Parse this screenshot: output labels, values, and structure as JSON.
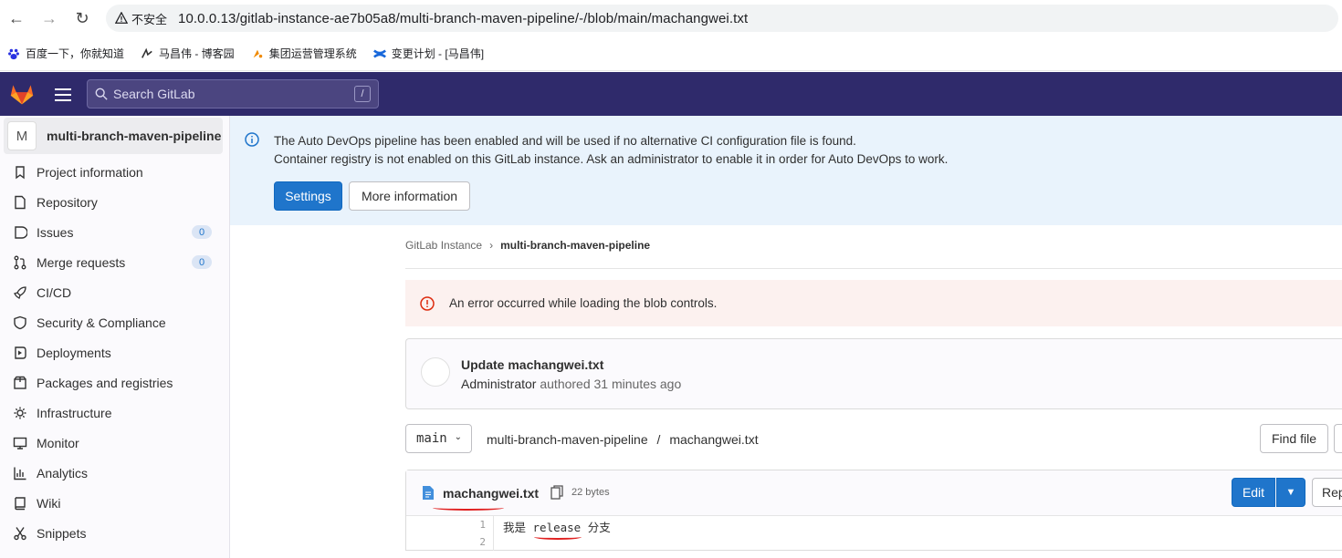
{
  "browser": {
    "insecure_label": "不安全",
    "url": "10.0.0.13/gitlab-instance-ae7b05a8/multi-branch-maven-pipeline/-/blob/main/machangwei.txt",
    "bookmarks": [
      "百度一下，你就知道",
      "马昌伟 - 博客园",
      "集团运营管理系统",
      "变更计划 - [马昌伟]"
    ]
  },
  "topbar": {
    "search_placeholder": "Search GitLab",
    "search_shortcut": "/"
  },
  "sidebar": {
    "project_initial": "M",
    "project_name": "multi-branch-maven-pipeline",
    "items": [
      {
        "label": "Project information"
      },
      {
        "label": "Repository"
      },
      {
        "label": "Issues",
        "count": "0"
      },
      {
        "label": "Merge requests",
        "count": "0"
      },
      {
        "label": "CI/CD"
      },
      {
        "label": "Security & Compliance"
      },
      {
        "label": "Deployments"
      },
      {
        "label": "Packages and registries"
      },
      {
        "label": "Infrastructure"
      },
      {
        "label": "Monitor"
      },
      {
        "label": "Analytics"
      },
      {
        "label": "Wiki"
      },
      {
        "label": "Snippets"
      }
    ]
  },
  "banner": {
    "line1": "The Auto DevOps pipeline has been enabled and will be used if no alternative CI configuration file is found.",
    "line2": "Container registry is not enabled on this GitLab instance. Ask an administrator to enable it in order for Auto DevOps to work.",
    "settings_label": "Settings",
    "more_info_label": "More information"
  },
  "breadcrumb": {
    "root": "GitLab Instance",
    "current": "multi-branch-maven-pipeline"
  },
  "error": {
    "message": "An error occurred while loading the blob controls."
  },
  "commit": {
    "title": "Update machangwei.txt",
    "author": "Administrator",
    "meta": "authored 31 minutes ago"
  },
  "file_nav": {
    "branch": "main",
    "project": "multi-branch-maven-pipeline",
    "separator": "/",
    "file": "machangwei.txt",
    "find_file_label": "Find file"
  },
  "file": {
    "name": "machangwei.txt",
    "size": "22 bytes",
    "edit_label": "Edit",
    "replace_label": "Replace",
    "lines": [
      {
        "number": "1",
        "text": "我是 release 分支"
      },
      {
        "number": "2",
        "text": ""
      }
    ]
  },
  "colors": {
    "brand": "#2f2a6b",
    "primary": "#1f75cb",
    "annotation": "#e02020"
  }
}
